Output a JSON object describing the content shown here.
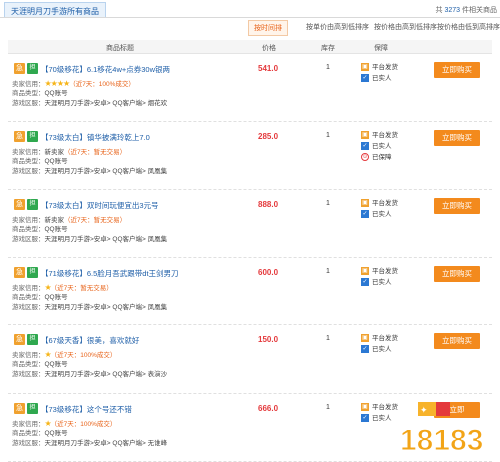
{
  "header": {
    "breadcrumb": "天涯明月刀手游所有商品",
    "count_prefix": "共",
    "count_num": "3273",
    "count_suffix": "件相关商品"
  },
  "sort": [
    "按时间排",
    "按单价由高到低排序",
    "按价格由高到低排序",
    "按价格由低到高排序"
  ],
  "columns": {
    "name": "商品标题",
    "price": "价格",
    "stock": "库存",
    "guarantee": "保障"
  },
  "colors": {
    "accent": "#f38a1d",
    "price": "#e4393c",
    "link": "#1f5fa8"
  },
  "products": [
    {
      "title": "【70级移花】6.1移花4w+点券30w银两",
      "price": "541.0",
      "stock": "1",
      "seller_label": "卖家信用：",
      "seller_value": "",
      "seller_stars": "★★★★",
      "seller_rate": "（近7天：100%成交）",
      "type_label": "商品类型：",
      "type": "QQ账号",
      "area_label": "游戏区服：",
      "area": "天涯明月刀手游>安卓> QQ客户端> 烟花欢",
      "guarantees": [
        "平台发货",
        "已实人"
      ],
      "icons": [
        "box-icon",
        "user-check-icon"
      ],
      "button": "立即购买"
    },
    {
      "title": "【73级太白】镇华披满玲乾上7.0",
      "price": "285.0",
      "stock": "1",
      "seller_label": "卖家信用：",
      "seller_value": "新卖家",
      "seller_stars": "",
      "seller_rate": "（近7天：暂无交易）",
      "type_label": "商品类型：",
      "type": "QQ账号",
      "area_label": "游戏区服：",
      "area": "天涯明月刀手游>安卓> QQ客户端> 凤凰集",
      "guarantees": [
        "平台发货",
        "已实人",
        "已保障"
      ],
      "icons": [
        "box-icon",
        "user-check-icon",
        "shield-icon"
      ],
      "button": "立即购买"
    },
    {
      "title": "【73级太白】双时间玩便宜出3元号",
      "price": "888.0",
      "stock": "1",
      "seller_label": "卖家信用：",
      "seller_value": "新卖家",
      "seller_stars": "",
      "seller_rate": "（近7天：暂无交易）",
      "type_label": "商品类型：",
      "type": "QQ账号",
      "area_label": "游戏区服：",
      "area": "天涯明月刀手游>安卓> QQ客户端> 凤凰集",
      "guarantees": [
        "平台发货",
        "已实人"
      ],
      "icons": [
        "box-icon",
        "user-check-icon"
      ],
      "button": "立即购买"
    },
    {
      "title": "【71级移花】6.5脸月吾武跟带dt王剑男刀",
      "price": "600.0",
      "stock": "1",
      "seller_label": "卖家信用：",
      "seller_value": "",
      "seller_stars": "★",
      "seller_rate": "（近7天：暂无交易）",
      "type_label": "商品类型：",
      "type": "QQ账号",
      "area_label": "游戏区服：",
      "area": "天涯明月刀手游>安卓> QQ客户端> 凤凰集",
      "guarantees": [
        "平台发货",
        "已实人"
      ],
      "icons": [
        "box-icon",
        "user-check-icon"
      ],
      "button": "立即购买"
    },
    {
      "title": "【67级天香】很美，喜欢就好",
      "price": "150.0",
      "stock": "1",
      "seller_label": "卖家信用：",
      "seller_value": "",
      "seller_stars": "★",
      "seller_rate": "（近7天：100%成交）",
      "type_label": "商品类型：",
      "type": "QQ账号",
      "area_label": "游戏区服：",
      "area": "天涯明月刀手游>安卓> QQ客户端> 表演沙",
      "guarantees": [
        "平台发货",
        "已实人"
      ],
      "icons": [
        "box-icon",
        "user-check-icon"
      ],
      "button": "立即购买"
    },
    {
      "title": "【73级移花】这个号还不错",
      "price": "666.0",
      "stock": "1",
      "seller_label": "卖家信用：",
      "seller_value": "",
      "seller_stars": "★",
      "seller_rate": "（近7天：100%成交）",
      "type_label": "商品类型：",
      "type": "QQ账号",
      "area_label": "游戏区服：",
      "area": "天涯明月刀手游>安卓> QQ客户端> 无谁峰",
      "guarantees": [
        "平台发货",
        "已实人"
      ],
      "icons": [
        "box-icon",
        "user-check-icon"
      ],
      "button": "立即"
    }
  ],
  "tag_labels": {
    "first": "急",
    "second": "担"
  },
  "watermark": {
    "text": "18183"
  }
}
